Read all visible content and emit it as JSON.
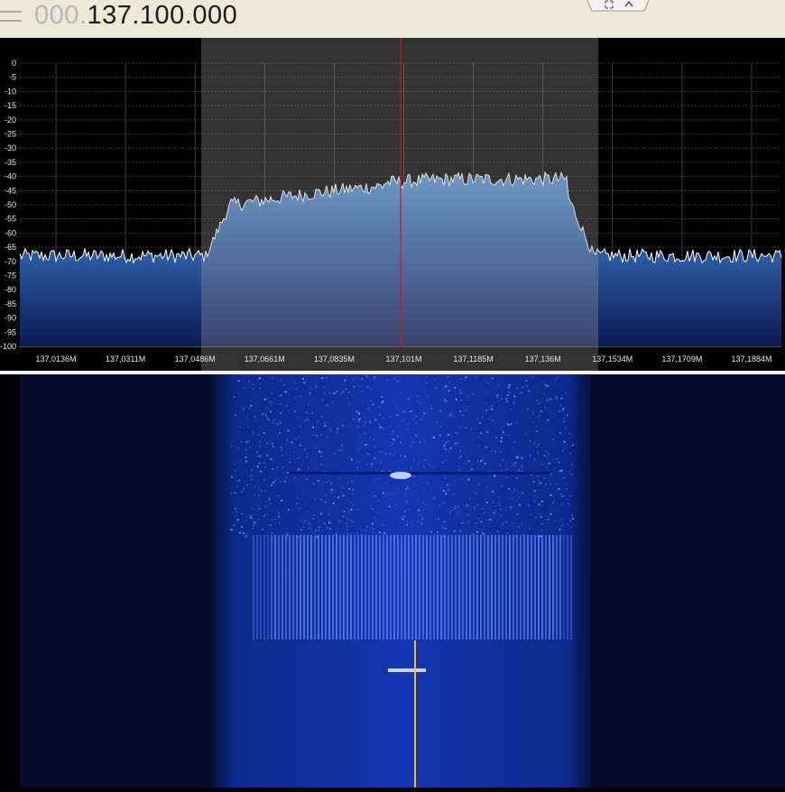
{
  "header": {
    "frequency_prefix": "000.",
    "frequency_main": "137.100.000"
  },
  "spectrum": {
    "y_ticks": [
      "0",
      "-5",
      "-10",
      "-15",
      "-20",
      "-25",
      "-30",
      "-35",
      "-40",
      "-45",
      "-50",
      "-55",
      "-60",
      "-65",
      "-70",
      "-75",
      "-80",
      "-85",
      "-90",
      "-95",
      "-100"
    ],
    "x_ticks": [
      "137,0136M",
      "137,0311M",
      "137,0486M",
      "137,0661M",
      "137,0835M",
      "137,101M",
      "137,1185M",
      "137,136M",
      "137,1534M",
      "137,1709M",
      "137,1884M"
    ],
    "y_range_db": [
      -100,
      0
    ],
    "noise_floor_db": -68,
    "signal_level_db": -42,
    "filter_band_label": "passband",
    "colors": {
      "plot_fill_top": "#4d86c8",
      "plot_fill_bottom": "#0a1a55",
      "trace": "#ffffff",
      "grid": "#5a5a5a",
      "center_marker": "#e01010",
      "filter_overlay": "#808080"
    }
  },
  "waterfall": {
    "tuning_marker_color": "#ffb347"
  }
}
